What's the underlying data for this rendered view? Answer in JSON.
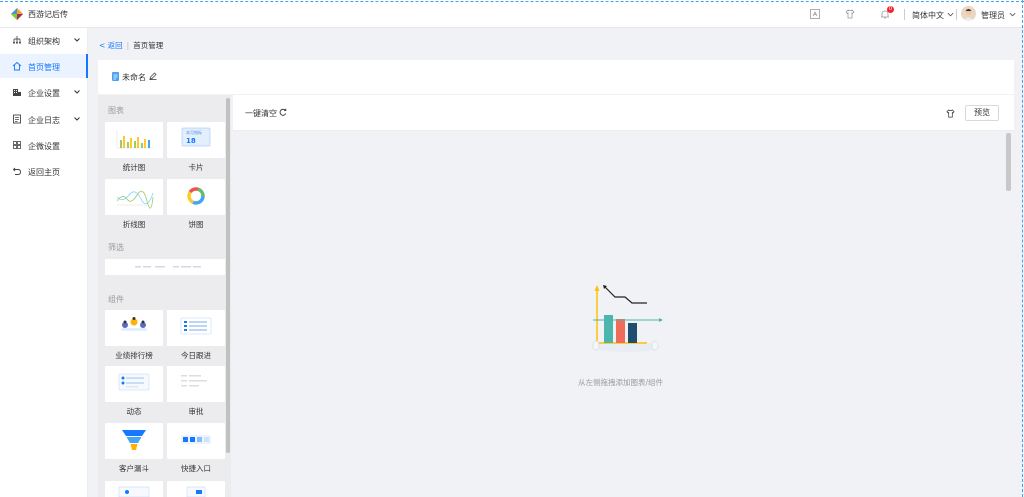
{
  "app": {
    "title": "西游记后传"
  },
  "header": {
    "icons": [
      "translate-icon",
      "shirt-icon",
      "bell-icon"
    ],
    "notification_count": "0",
    "language": "简体中文",
    "user": "管理员"
  },
  "sidebar": {
    "items": [
      {
        "label": "组织架构",
        "icon": "org-icon",
        "expandable": true,
        "active": false
      },
      {
        "label": "首页管理",
        "icon": "home-icon",
        "expandable": false,
        "active": true
      },
      {
        "label": "企业设置",
        "icon": "building-icon",
        "expandable": true,
        "active": false
      },
      {
        "label": "企业日志",
        "icon": "log-icon",
        "expandable": true,
        "active": false
      },
      {
        "label": "企微设置",
        "icon": "grid-icon",
        "expandable": false,
        "active": false
      },
      {
        "label": "返回主页",
        "icon": "return-icon",
        "expandable": false,
        "active": false
      }
    ]
  },
  "breadcrumb": {
    "back": "返回",
    "current": "首页管理"
  },
  "page": {
    "name": "未命名"
  },
  "palette": {
    "sections": [
      {
        "title": "图表",
        "cards": [
          "统计图",
          "卡片",
          "折线图",
          "饼图"
        ]
      },
      {
        "title": "筛选"
      },
      {
        "title": "组件",
        "cards": [
          "业绩排行榜",
          "今日跟进",
          "动态",
          "审批",
          "客户漏斗",
          "快捷入口"
        ]
      }
    ],
    "card_thumb_text": {
      "kpi_title": "本月指标",
      "kpi_value": "18"
    }
  },
  "toolbar": {
    "clear_label": "一键清空",
    "preview_label": "预览"
  },
  "canvas": {
    "empty_text": "从左侧拖拽添加图表/组件"
  },
  "colors": {
    "accent": "#1677ff",
    "active_bg": "#eaf3ff",
    "badge": "#f5222d"
  }
}
